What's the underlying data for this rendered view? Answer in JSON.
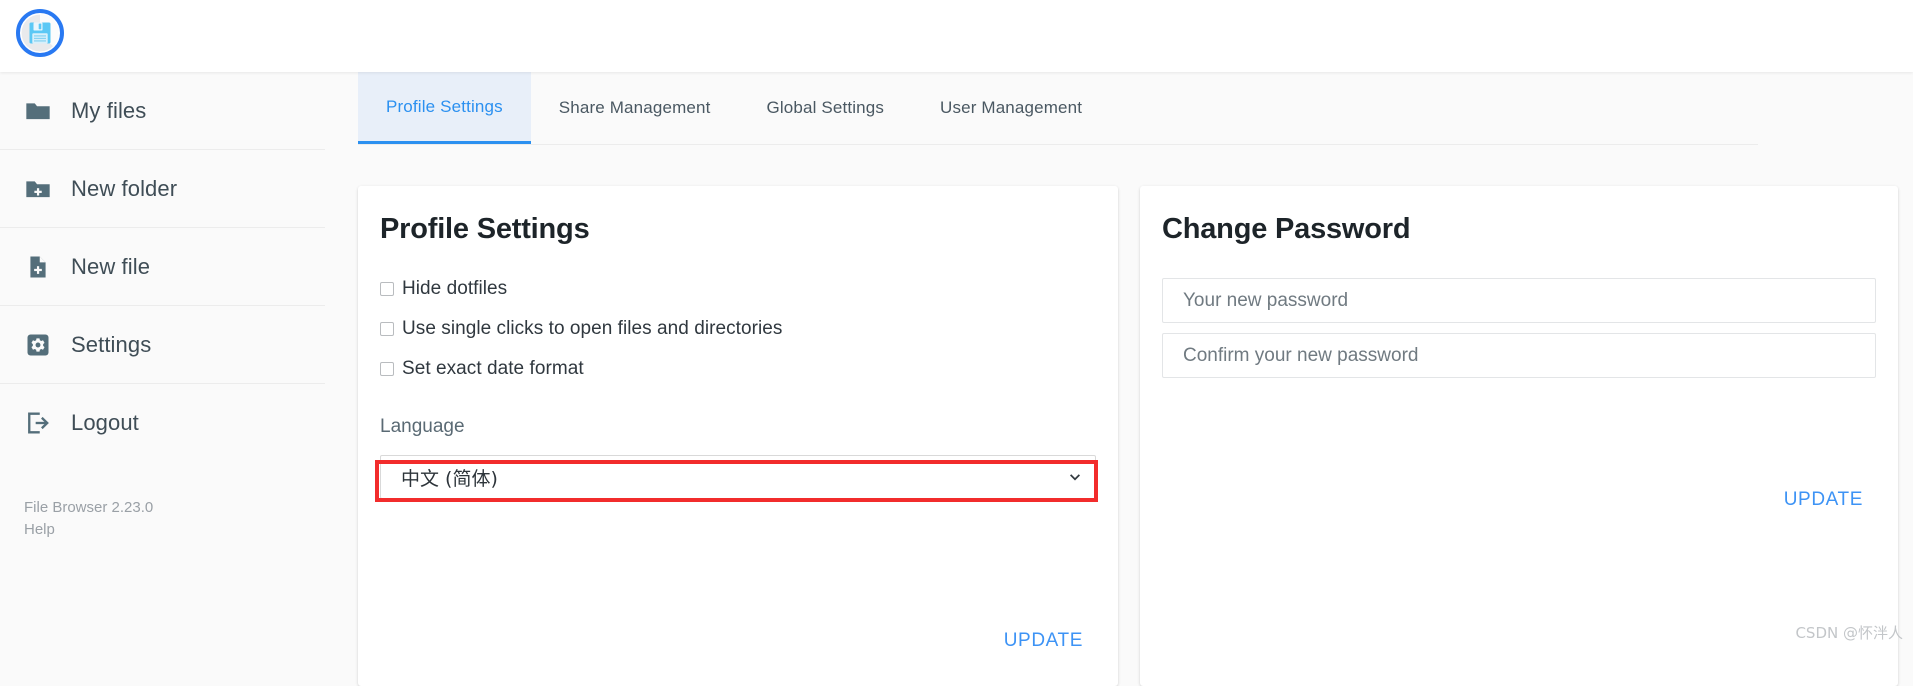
{
  "app": {
    "logo_icon": "floppy-disk-logo",
    "version_text": "File Browser 2.23.0",
    "help_label": "Help"
  },
  "sidebar": {
    "items": [
      {
        "label": "My files",
        "icon": "folder-icon"
      },
      {
        "label": "New folder",
        "icon": "folder-plus-icon"
      },
      {
        "label": "New file",
        "icon": "file-plus-icon"
      },
      {
        "label": "Settings",
        "icon": "gear-icon"
      },
      {
        "label": "Logout",
        "icon": "logout-icon"
      }
    ]
  },
  "tabs": [
    {
      "label": "Profile Settings",
      "active": true
    },
    {
      "label": "Share Management",
      "active": false
    },
    {
      "label": "Global Settings",
      "active": false
    },
    {
      "label": "User Management",
      "active": false
    }
  ],
  "profile_card": {
    "title": "Profile Settings",
    "checkboxes": [
      {
        "label": "Hide dotfiles",
        "checked": false
      },
      {
        "label": "Use single clicks to open files and directories",
        "checked": false
      },
      {
        "label": "Set exact date format",
        "checked": false
      }
    ],
    "language_label": "Language",
    "language_value": "中文 (简体)",
    "language_options": [
      "中文 (简体)"
    ],
    "update_label": "UPDATE",
    "highlight_color": "#f22c2c"
  },
  "password_card": {
    "title": "Change Password",
    "new_password": {
      "value": "",
      "placeholder": "Your new password"
    },
    "confirm_password": {
      "value": "",
      "placeholder": "Confirm your new password"
    },
    "update_label": "UPDATE"
  },
  "watermark": {
    "text": "CSDN @怀泮人"
  },
  "colors": {
    "accent": "#2b90f0",
    "link": "#3d93f5",
    "active_tab_bg": "#e8eff9",
    "sidebar_bg": "#fafafa",
    "card_bg": "#ffffff",
    "icon": "#546e7a",
    "highlight": "#f22c2c"
  }
}
